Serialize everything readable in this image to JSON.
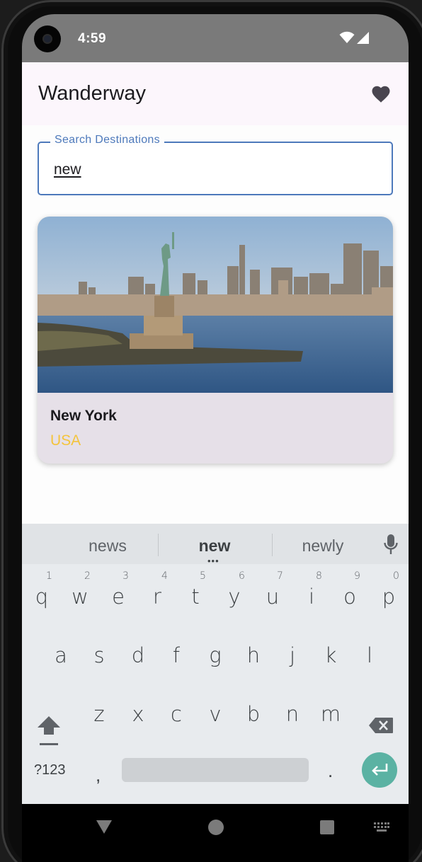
{
  "status_bar": {
    "time": "4:59"
  },
  "app_bar": {
    "title": "Wanderway",
    "favorites_icon": "heart-icon"
  },
  "search": {
    "label": "Search Destinations",
    "value": "new"
  },
  "results": [
    {
      "name": "New York",
      "country": "USA",
      "image": "statue-of-liberty-skyline-photo"
    }
  ],
  "colors": {
    "accent": "#4d79bb",
    "country_text": "#f4c43c",
    "card_bg": "#e6e0e8",
    "enter_key": "#5bb2a3"
  },
  "keyboard": {
    "suggestions": [
      "news",
      "new",
      "newly"
    ],
    "row1": [
      {
        "key": "q",
        "hint": "1"
      },
      {
        "key": "w",
        "hint": "2"
      },
      {
        "key": "e",
        "hint": "3"
      },
      {
        "key": "r",
        "hint": "4"
      },
      {
        "key": "t",
        "hint": "5"
      },
      {
        "key": "y",
        "hint": "6"
      },
      {
        "key": "u",
        "hint": "7"
      },
      {
        "key": "i",
        "hint": "8"
      },
      {
        "key": "o",
        "hint": "9"
      },
      {
        "key": "p",
        "hint": "0"
      }
    ],
    "row2": [
      "a",
      "s",
      "d",
      "f",
      "g",
      "h",
      "j",
      "k",
      "l"
    ],
    "row3": [
      "z",
      "x",
      "c",
      "v",
      "b",
      "n",
      "m"
    ],
    "symbols_label": "?123",
    "comma": ",",
    "period": "."
  }
}
